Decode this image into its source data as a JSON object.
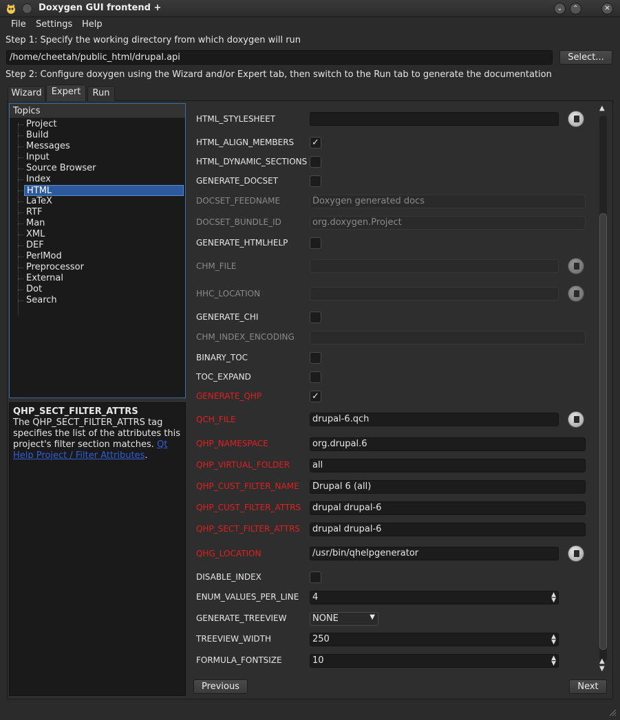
{
  "window": {
    "title": "Doxygen GUI frontend +",
    "minimize_glyph": "⌄",
    "maximize_glyph": "⌃",
    "close_glyph": "✕"
  },
  "menu": {
    "file": "File",
    "settings": "Settings",
    "help": "Help"
  },
  "step1": {
    "label": "Step 1: Specify the working directory from which doxygen will run",
    "path": "/home/cheetah/public_html/drupal.api",
    "select_label": "Select..."
  },
  "step2": {
    "label": "Step 2: Configure doxygen using the Wizard and/or Expert tab, then switch to the Run tab to generate the documentation"
  },
  "tabs": {
    "wizard": "Wizard",
    "expert": "Expert",
    "run": "Run"
  },
  "topics": {
    "header": "Topics",
    "items": [
      "Project",
      "Build",
      "Messages",
      "Input",
      "Source Browser",
      "Index",
      "HTML",
      "LaTeX",
      "RTF",
      "Man",
      "XML",
      "DEF",
      "PerlMod",
      "Preprocessor",
      "External",
      "Dot",
      "Search"
    ],
    "selected": "HTML"
  },
  "help": {
    "title": "QHP_SECT_FILTER_ATTRS",
    "text": "The QHP_SECT_FILTER_ATTRS tag specifies the list of the attributes this project's filter section matches.",
    "link_text": "Qt Help Project / Filter Attributes",
    "trailing": "."
  },
  "options": {
    "html_stylesheet": {
      "label": "HTML_STYLESHEET",
      "value": ""
    },
    "html_align_members": {
      "label": "HTML_ALIGN_MEMBERS",
      "check": "✓"
    },
    "html_dynamic_sections": {
      "label": "HTML_DYNAMIC_SECTIONS"
    },
    "generate_docset": {
      "label": "GENERATE_DOCSET"
    },
    "docset_feedname": {
      "label": "DOCSET_FEEDNAME",
      "value": "Doxygen generated docs"
    },
    "docset_bundle_id": {
      "label": "DOCSET_BUNDLE_ID",
      "value": "org.doxygen.Project"
    },
    "generate_htmlhelp": {
      "label": "GENERATE_HTMLHELP"
    },
    "chm_file": {
      "label": "CHM_FILE",
      "value": ""
    },
    "hhc_location": {
      "label": "HHC_LOCATION",
      "value": ""
    },
    "generate_chi": {
      "label": "GENERATE_CHI"
    },
    "chm_index_encoding": {
      "label": "CHM_INDEX_ENCODING",
      "value": ""
    },
    "binary_toc": {
      "label": "BINARY_TOC"
    },
    "toc_expand": {
      "label": "TOC_EXPAND"
    },
    "generate_qhp": {
      "label": "GENERATE_QHP",
      "check": "✓"
    },
    "qch_file": {
      "label": "QCH_FILE",
      "value": "drupal-6.qch"
    },
    "qhp_namespace": {
      "label": "QHP_NAMESPACE",
      "value": "org.drupal.6"
    },
    "qhp_virtual_folder": {
      "label": "QHP_VIRTUAL_FOLDER",
      "value": "all"
    },
    "qhp_cust_filter_name": {
      "label": "QHP_CUST_FILTER_NAME",
      "value": "Drupal 6 (all)"
    },
    "qhp_cust_filter_attrs": {
      "label": "QHP_CUST_FILTER_ATTRS",
      "value": "drupal drupal-6"
    },
    "qhp_sect_filter_attrs": {
      "label": "QHP_SECT_FILTER_ATTRS",
      "value": "drupal drupal-6"
    },
    "qhg_location": {
      "label": "QHG_LOCATION",
      "value": "/usr/bin/qhelpgenerator"
    },
    "disable_index": {
      "label": "DISABLE_INDEX"
    },
    "enum_values_per_line": {
      "label": "ENUM_VALUES_PER_LINE",
      "value": "4"
    },
    "generate_treeview": {
      "label": "GENERATE_TREEVIEW",
      "value": "NONE"
    },
    "treeview_width": {
      "label": "TREEVIEW_WIDTH",
      "value": "250"
    },
    "formula_fontsize": {
      "label": "FORMULA_FONTSIZE",
      "value": "10"
    }
  },
  "nav": {
    "previous": "Previous",
    "next": "Next"
  },
  "colors": {
    "changed": "#e02020",
    "selection": "#2d5a9c",
    "link": "#2f5fd8"
  }
}
